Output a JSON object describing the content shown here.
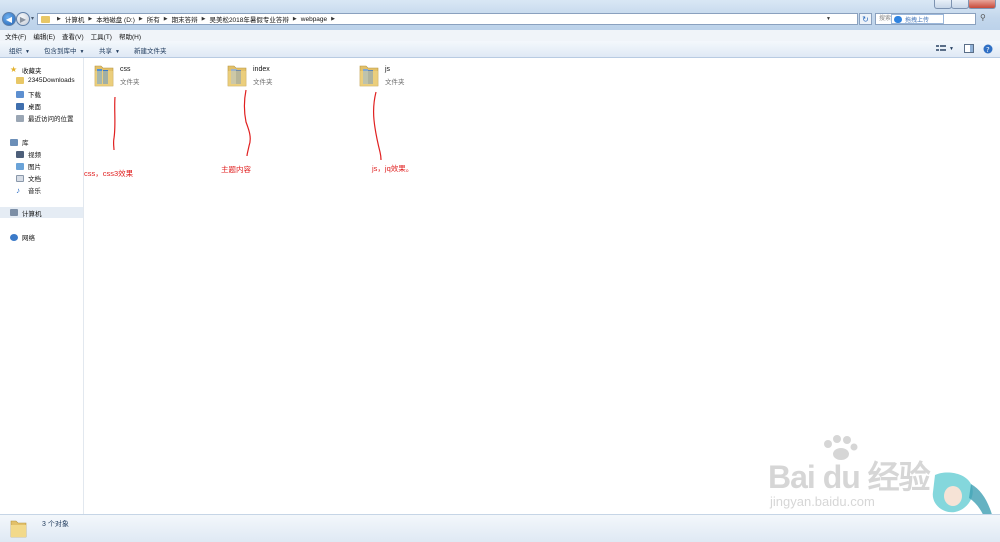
{
  "window": {
    "title_buttons": [
      "minimize",
      "maximize",
      "close"
    ]
  },
  "address_bar": {
    "breadcrumbs": [
      "计算机",
      "本地磁盘 (D:)",
      "所有",
      "期末答辩",
      "吴美松2018年暑假专业答辩",
      "webpage"
    ],
    "search_placeholder": "搜索 webpage",
    "upload_label": "拖拽上传"
  },
  "menu": {
    "items": [
      "文件(F)",
      "编辑(E)",
      "查看(V)",
      "工具(T)",
      "帮助(H)"
    ]
  },
  "toolbar": {
    "organize": "组织",
    "include_in_library": "包含到库中",
    "share": "共享",
    "new_folder": "新建文件夹"
  },
  "nav": {
    "favorites_label": "收藏夹",
    "favorites": [
      "2345Downloads",
      "下载",
      "桌面",
      "最近访问的位置"
    ],
    "libraries_label": "库",
    "libraries": [
      "视频",
      "图片",
      "文档",
      "音乐"
    ],
    "computer_label": "计算机",
    "network_label": "网络"
  },
  "files": [
    {
      "name": "css",
      "type": "文件夹"
    },
    {
      "name": "index",
      "type": "文件夹"
    },
    {
      "name": "js",
      "type": "文件夹"
    }
  ],
  "annotations": {
    "css": "css，css3效果",
    "index": "主题内容",
    "js": "js，jq效果。"
  },
  "status": {
    "count": "3 个对象"
  },
  "watermark": {
    "brand": "Bai  du 经验",
    "url": "jingyan.baidu.com"
  },
  "colors": {
    "annotation": "#e02020",
    "folder": "#e8c766",
    "accent": "#1f63b8"
  }
}
